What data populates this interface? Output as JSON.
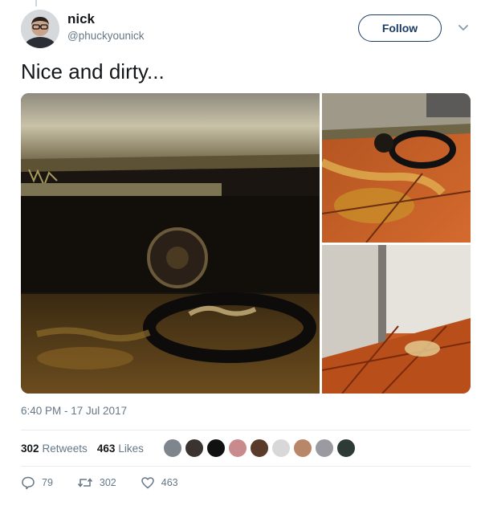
{
  "tweet": {
    "author_name": "nick",
    "author_handle": "@phuckyounick",
    "follow_label": "Follow",
    "text": "Nice and dirty...",
    "timestamp": "6:40 PM - 17 Jul 2017"
  },
  "stats": {
    "retweets_count": "302",
    "retweets_label": "Retweets",
    "likes_count": "463",
    "likes_label": "Likes"
  },
  "actions": {
    "reply_count": "79",
    "retweet_count": "302",
    "like_count": "463"
  },
  "icons": {
    "more": "chevron-down-icon",
    "reply": "reply-icon",
    "retweet": "retweet-icon",
    "like": "heart-icon"
  },
  "colors": {
    "follow_border": "#1b3d63",
    "secondary_text": "#657786"
  }
}
